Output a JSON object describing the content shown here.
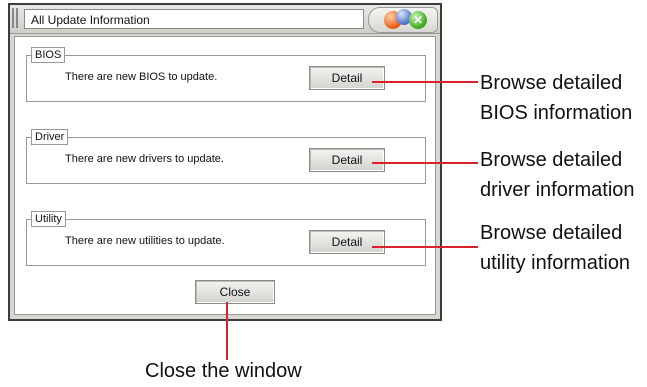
{
  "window": {
    "title": "All Update Information",
    "close_glyph": "✕"
  },
  "groups": [
    {
      "label": "BIOS",
      "message": "There are new BIOS to update.",
      "button": "Detail"
    },
    {
      "label": "Driver",
      "message": "There are new drivers to update.",
      "button": "Detail"
    },
    {
      "label": "Utility",
      "message": "There are new utilities to update.",
      "button": "Detail"
    }
  ],
  "close_button": "Close",
  "callouts": {
    "bios": [
      "Browse detailed",
      "BIOS information"
    ],
    "driver": [
      "Browse detailed",
      "driver information"
    ],
    "utility": [
      "Browse detailed",
      "utility information"
    ],
    "close": "Close the window"
  },
  "colors": {
    "callout_line": "#d8232a",
    "window_frame": "#d7d7d2"
  }
}
